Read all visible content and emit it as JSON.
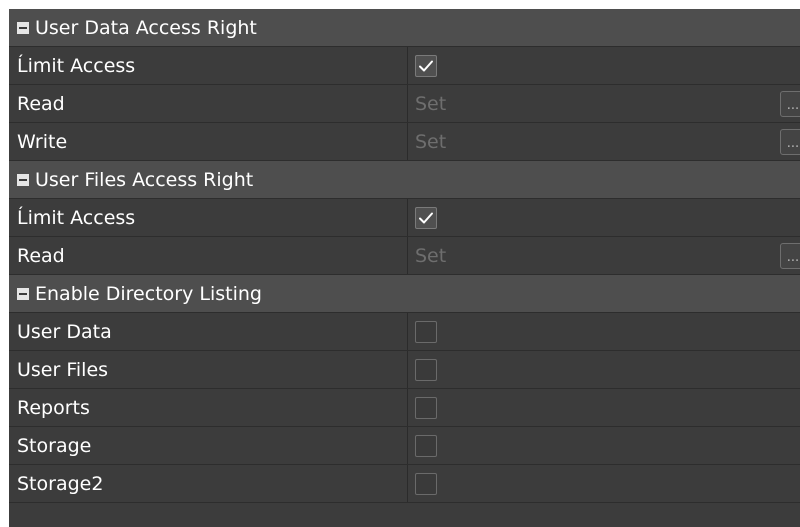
{
  "sections": [
    {
      "title": "User Data Access Right",
      "rows": [
        {
          "label": "Ĺimit Access",
          "type": "checkbox",
          "checked": true
        },
        {
          "label": "Read",
          "type": "set",
          "value": "Set",
          "button": "..."
        },
        {
          "label": "Write",
          "type": "set",
          "value": "Set",
          "button": "..."
        }
      ]
    },
    {
      "title": "User Files Access Right",
      "rows": [
        {
          "label": "Ĺimit Access",
          "type": "checkbox",
          "checked": true
        },
        {
          "label": "Read",
          "type": "set",
          "value": "Set",
          "button": "..."
        }
      ]
    },
    {
      "title": "Enable Directory Listing",
      "rows": [
        {
          "label": "User Data",
          "type": "checkbox",
          "checked": false
        },
        {
          "label": "User Files",
          "type": "checkbox",
          "checked": false
        },
        {
          "label": "Reports",
          "type": "checkbox",
          "checked": false
        },
        {
          "label": "Storage",
          "type": "checkbox",
          "checked": false
        },
        {
          "label": "Storage2",
          "type": "checkbox",
          "checked": false
        }
      ]
    }
  ],
  "colors": {
    "panel_bg": "#3c3c3c",
    "section_bg": "#4e4e4e",
    "text": "#ffffff",
    "disabled_text": "#6e6e6e"
  },
  "icons": {
    "collapse": "minus-icon",
    "check": "checkmark-icon",
    "browse": "ellipsis-icon"
  }
}
